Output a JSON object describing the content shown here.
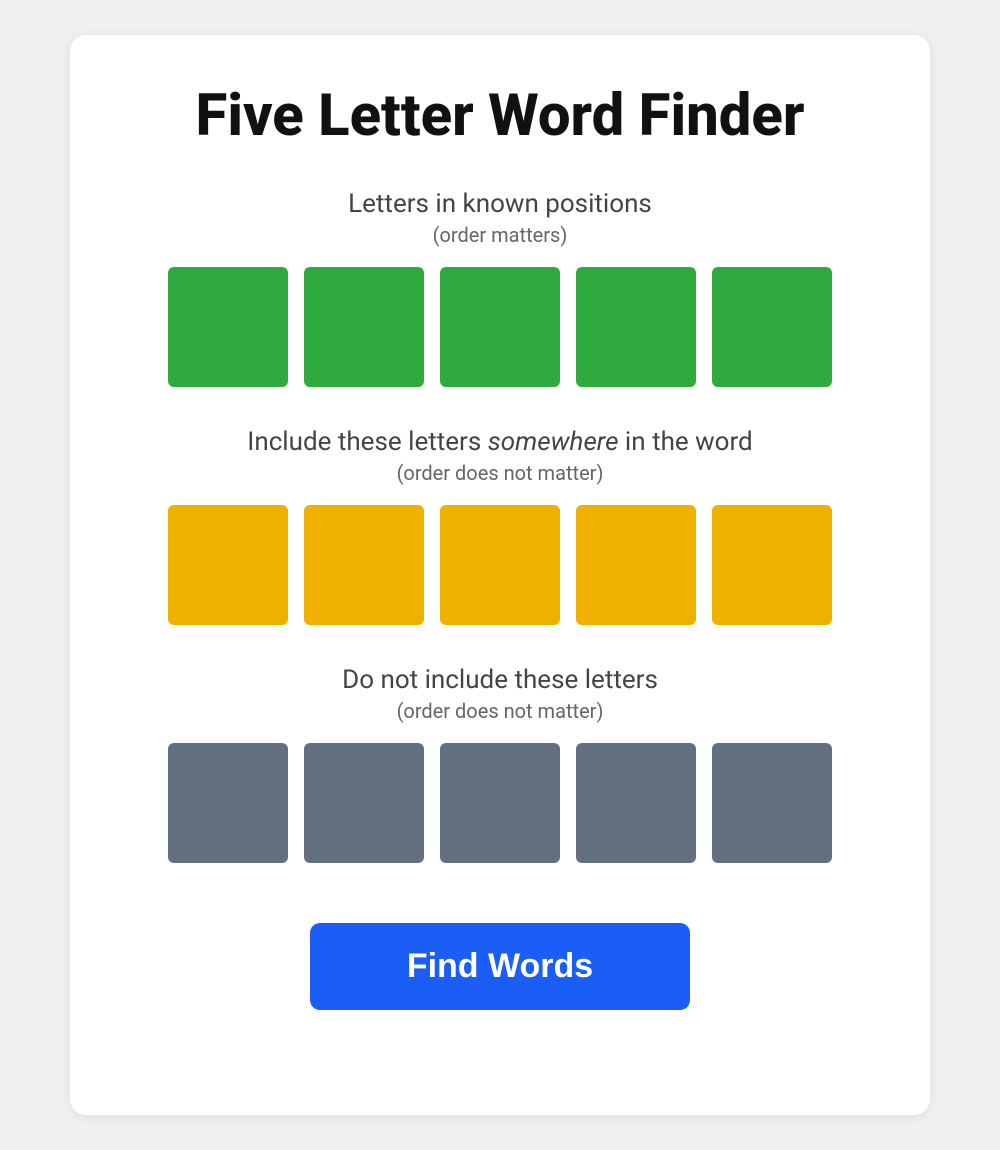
{
  "page": {
    "title": "Five Letter Word Finder",
    "background_color": "#f0f0f0"
  },
  "sections": {
    "known_positions": {
      "label": "Letters in known positions",
      "sublabel": "(order matters)",
      "tile_color": "green",
      "tiles": [
        "",
        "",
        "",
        "",
        ""
      ]
    },
    "include_letters": {
      "label": "Include these letters somewhere in the word",
      "sublabel": "(order does not matter)",
      "tile_color": "yellow",
      "tiles": [
        "",
        "",
        "",
        "",
        ""
      ]
    },
    "exclude_letters": {
      "label": "Do not include these letters",
      "sublabel": "(order does not matter)",
      "tile_color": "gray",
      "tiles": [
        "",
        "",
        "",
        "",
        ""
      ]
    }
  },
  "button": {
    "label": "Find Words"
  }
}
